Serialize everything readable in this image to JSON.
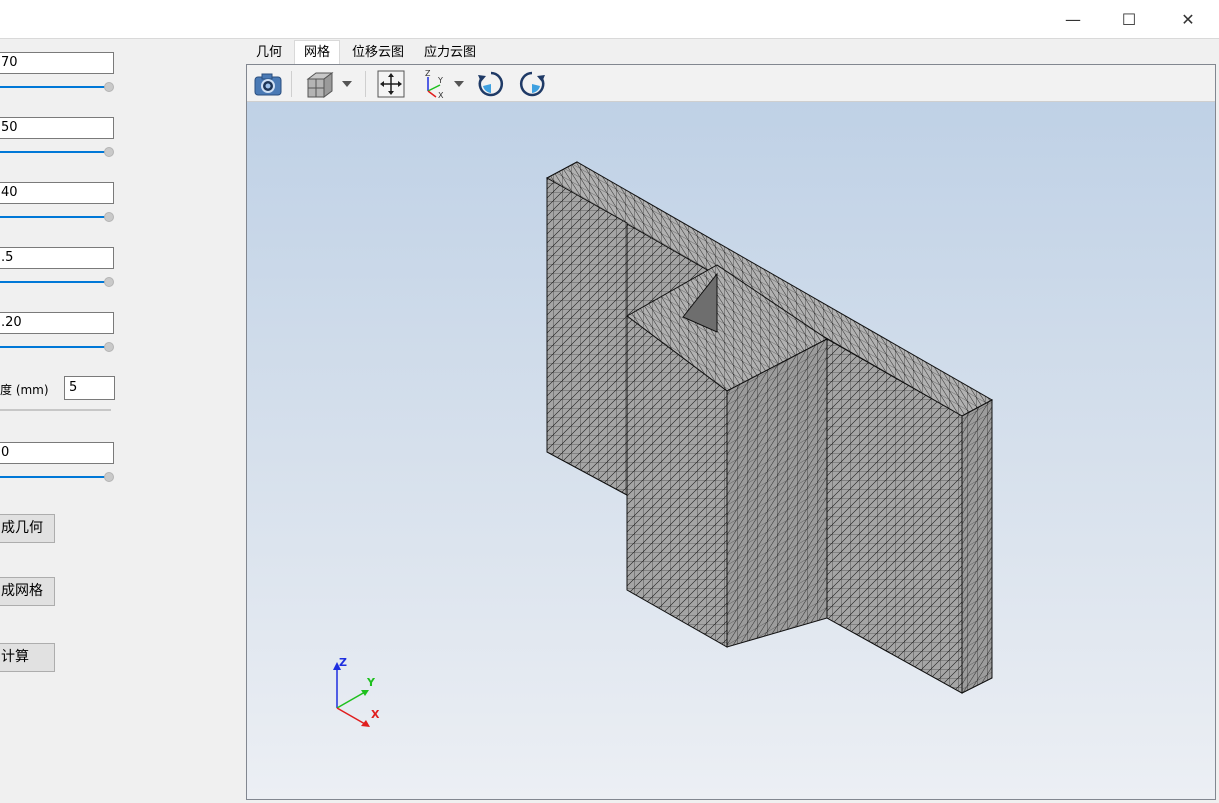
{
  "window": {
    "minimize_glyph": "—",
    "maximize_glyph": "☐",
    "close_glyph": "✕"
  },
  "params": {
    "field1": "70",
    "field2": "50",
    "field3": "40",
    "field4": ".5",
    "field5": ".20",
    "mesh_size_label": "度 (mm)",
    "mesh_size_value": "5",
    "field7": "0"
  },
  "buttons": {
    "gen_geometry": "成几何",
    "gen_mesh": "成网格",
    "compute": "计算"
  },
  "tabs": [
    "几何",
    "网格",
    "位移云图",
    "应力云图"
  ],
  "active_tab": "网格",
  "toolbar": {
    "icons": [
      "camera-icon",
      "cube-view-icon",
      "fit-view-icon",
      "axes-icon",
      "rotate-ccw-icon",
      "rotate-cw-icon"
    ]
  },
  "triad": {
    "z": "Z",
    "y": "Y",
    "x": "X"
  },
  "colors": {
    "accent": "#0078d7",
    "mesh_fill": "#a3a3a3",
    "axis_x": "#e01e1e",
    "axis_y": "#1ec01e",
    "axis_z": "#1e2ee0"
  }
}
